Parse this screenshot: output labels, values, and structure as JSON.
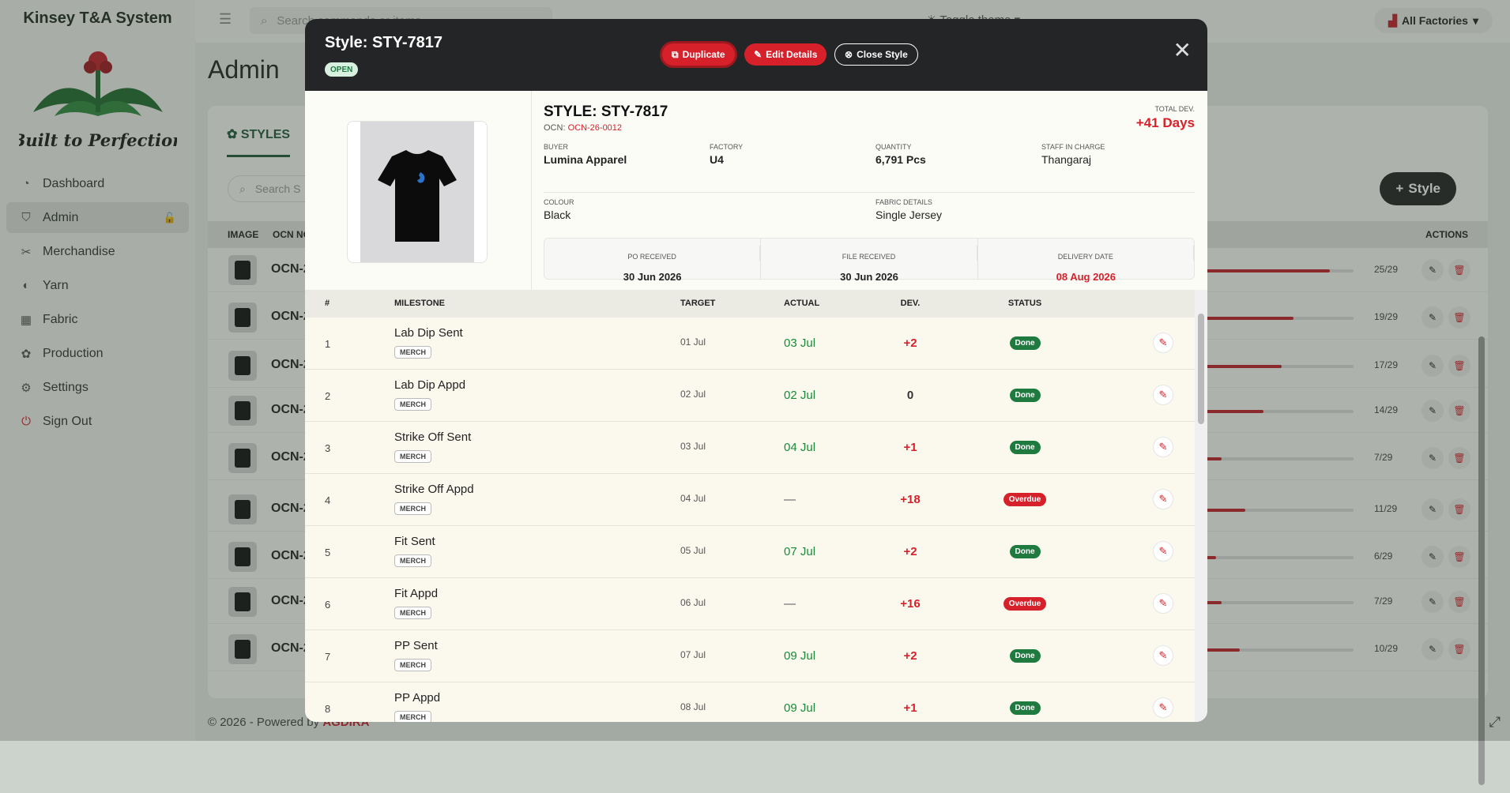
{
  "app": {
    "brand": "Kinsey T&A System",
    "logo_text": "Built to Perfection",
    "search_placeholder": "Search commands or items",
    "toggle_theme": "Toggle theme",
    "factories_label": "All Factories",
    "page_title": "Admin",
    "footer_text": "© 2026 - Powered by",
    "footer_brand": "AGDIRA"
  },
  "sidebar": {
    "items": [
      {
        "label": "Dashboard",
        "icon": "dashboard-icon"
      },
      {
        "label": "Admin",
        "icon": "shield-icon"
      },
      {
        "label": "Merchandise",
        "icon": "scissors-icon"
      },
      {
        "label": "Yarn",
        "icon": "yarn-icon"
      },
      {
        "label": "Fabric",
        "icon": "grid-icon"
      },
      {
        "label": "Production",
        "icon": "palette-icon"
      },
      {
        "label": "Settings",
        "icon": "gear-icon"
      },
      {
        "label": "Sign Out",
        "icon": "power-icon"
      }
    ]
  },
  "background": {
    "tab_label": "STYLES",
    "search_placeholder": "Search S",
    "add_style_label": "Style",
    "columns": {
      "image": "IMAGE",
      "ocn": "OCN NO",
      "actions": "ACTIONS"
    },
    "rows": [
      {
        "ocn": "OCN-2",
        "progress": 0.862,
        "count": "25/29"
      },
      {
        "ocn": "OCN-2",
        "progress": 0.655,
        "count": "19/29"
      },
      {
        "ocn": "OCN-2",
        "progress": 0.586,
        "count": "17/29"
      },
      {
        "ocn": "OCN-2",
        "progress": 0.483,
        "count": "14/29"
      },
      {
        "ocn": "OCN-2",
        "progress": 0.241,
        "count": "7/29"
      },
      {
        "ocn": "OCN-2",
        "progress": 0.379,
        "count": "11/29"
      },
      {
        "ocn": "OCN-2",
        "progress": 0.207,
        "count": "6/29"
      },
      {
        "ocn": "OCN-2",
        "progress": 0.241,
        "count": "7/29"
      },
      {
        "ocn": "OCN-2",
        "progress": 0.345,
        "count": "10/29"
      }
    ]
  },
  "modal": {
    "title": "Style: STY-7817",
    "status_badge": "OPEN",
    "buttons": {
      "duplicate": "Duplicate",
      "edit": "Edit Details",
      "close_style": "Close Style"
    },
    "style_heading": "STYLE: STY-7817",
    "ocn_label": "OCN:",
    "ocn_value": "OCN-26-0012",
    "total_dev_label": "TOTAL DEV.",
    "total_dev_value": "+41 Days",
    "fields": {
      "buyer_label": "BUYER",
      "buyer": "Lumina Apparel",
      "factory_label": "FACTORY",
      "factory": "U4",
      "quantity_label": "QUANTITY",
      "quantity": "6,791 Pcs",
      "staff_label": "STAFF IN CHARGE",
      "staff": "Thangaraj",
      "colour_label": "COLOUR",
      "colour": "Black",
      "fabric_label": "FABRIC DETAILS",
      "fabric": "Single Jersey"
    },
    "dates": {
      "po_label": "PO RECEIVED",
      "po": "30 Jun 2026",
      "file_label": "FILE RECEIVED",
      "file": "30 Jun 2026",
      "delivery_label": "DELIVERY DATE",
      "delivery": "08 Aug 2026"
    },
    "table": {
      "headers": {
        "num": "#",
        "milestone": "MILESTONE",
        "target": "TARGET",
        "actual": "ACTUAL",
        "dev": "DEV.",
        "status": "STATUS"
      },
      "rows": [
        {
          "num": "1",
          "name": "Lab Dip Sent",
          "tag": "MERCH",
          "target": "01 Jul",
          "actual": "03 Jul",
          "dev": "+2",
          "status": "Done"
        },
        {
          "num": "2",
          "name": "Lab Dip Appd",
          "tag": "MERCH",
          "target": "02 Jul",
          "actual": "02 Jul",
          "dev": "0",
          "status": "Done"
        },
        {
          "num": "3",
          "name": "Strike Off Sent",
          "tag": "MERCH",
          "target": "03 Jul",
          "actual": "04 Jul",
          "dev": "+1",
          "status": "Done"
        },
        {
          "num": "4",
          "name": "Strike Off Appd",
          "tag": "MERCH",
          "target": "04 Jul",
          "actual": "—",
          "dev": "+18",
          "status": "Overdue"
        },
        {
          "num": "5",
          "name": "Fit Sent",
          "tag": "MERCH",
          "target": "05 Jul",
          "actual": "07 Jul",
          "dev": "+2",
          "status": "Done"
        },
        {
          "num": "6",
          "name": "Fit Appd",
          "tag": "MERCH",
          "target": "06 Jul",
          "actual": "—",
          "dev": "+16",
          "status": "Overdue"
        },
        {
          "num": "7",
          "name": "PP Sent",
          "tag": "MERCH",
          "target": "07 Jul",
          "actual": "09 Jul",
          "dev": "+2",
          "status": "Done"
        },
        {
          "num": "8",
          "name": "PP Appd",
          "tag": "MERCH",
          "target": "08 Jul",
          "actual": "09 Jul",
          "dev": "+1",
          "status": "Done"
        }
      ]
    }
  },
  "colors": {
    "accent_red": "#d6212b",
    "done_green": "#1f7a3f",
    "header_dark": "#232526",
    "brand_green": "#1f5a3a"
  }
}
